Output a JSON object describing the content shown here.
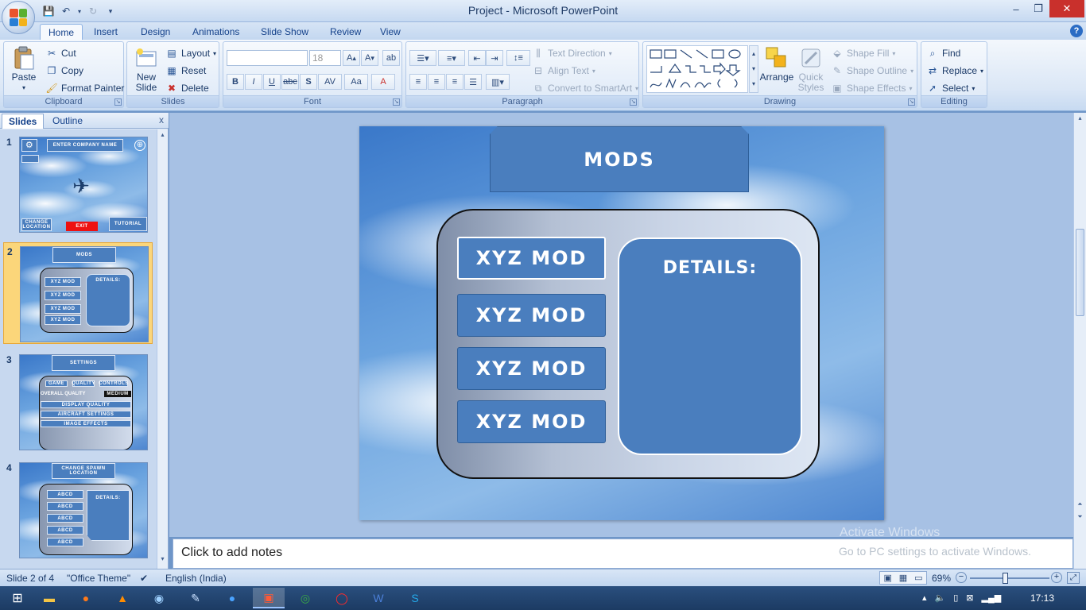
{
  "window": {
    "title": "Project - Microsoft PowerPoint",
    "minimize": "–",
    "restore": "❐",
    "close": "✕"
  },
  "ribbon_tabs": [
    "Home",
    "Insert",
    "Design",
    "Animations",
    "Slide Show",
    "Review",
    "View"
  ],
  "clipboard": {
    "paste": "Paste",
    "cut": "Cut",
    "copy": "Copy",
    "format_painter": "Format Painter",
    "label": "Clipboard"
  },
  "slides_group": {
    "new_slide": "New Slide",
    "layout": "Layout",
    "reset": "Reset",
    "delete": "Delete",
    "label": "Slides"
  },
  "font_group": {
    "font_name": "",
    "font_size": "18",
    "label": "Font"
  },
  "paragraph": {
    "text_direction": "Text Direction",
    "align_text": "Align Text",
    "convert_smartart": "Convert to SmartArt",
    "label": "Paragraph"
  },
  "drawing": {
    "arrange": "Arrange",
    "quick_styles": "Quick Styles",
    "shape_fill": "Shape Fill",
    "shape_outline": "Shape Outline",
    "shape_effects": "Shape Effects",
    "label": "Drawing"
  },
  "editing": {
    "find": "Find",
    "replace": "Replace",
    "select": "Select",
    "label": "Editing"
  },
  "pane": {
    "tab_slides": "Slides",
    "tab_outline": "Outline",
    "close": "x"
  },
  "thumbnails": [
    {
      "number": "1",
      "title": "ENTER COMPANY NAME",
      "labels": [
        "CHANGE LOCATION",
        "EXIT",
        "TUTORIAL"
      ]
    },
    {
      "number": "2",
      "title": "MODS",
      "labels": [
        "XYZ MOD",
        "XYZ MOD",
        "XYZ MOD",
        "XYZ MOD",
        "DETAILS:"
      ]
    },
    {
      "number": "3",
      "title": "SETTINGS",
      "labels": [
        "GAME",
        "QUALITY",
        "CONTROLS",
        "OVERALL QUALITY",
        "MEDIUM",
        "DISPLAY QUALITY",
        "AIRCRAFT SETTINGS",
        "IMAGE EFFECTS"
      ]
    },
    {
      "number": "4",
      "title": "CHANGE SPAWN LOCATION",
      "labels": [
        "ABCD",
        "ABCD",
        "ABCD",
        "ABCD",
        "ABCD",
        "DETAILS:"
      ]
    }
  ],
  "slide": {
    "title": "MODS",
    "mods": [
      "XYZ MOD",
      "XYZ MOD",
      "XYZ MOD",
      "XYZ MOD"
    ],
    "details_title": "DETAILS:"
  },
  "notes": {
    "placeholder": "Click to add notes"
  },
  "watermark": {
    "line1": "Activate Windows",
    "line2": "Go to PC settings to activate Windows."
  },
  "status": {
    "slide_info": "Slide 2 of 4",
    "theme": "\"Office Theme\"",
    "language": "English (India)",
    "zoom": "69%",
    "zoom_fraction": 0.45
  },
  "taskbar": {
    "time": "17:13"
  }
}
